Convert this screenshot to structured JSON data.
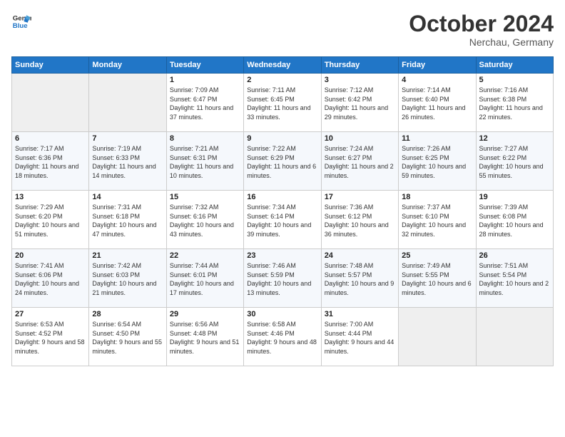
{
  "app": {
    "logo_line1": "General",
    "logo_line2": "Blue"
  },
  "header": {
    "month": "October 2024",
    "location": "Nerchau, Germany"
  },
  "weekdays": [
    "Sunday",
    "Monday",
    "Tuesday",
    "Wednesday",
    "Thursday",
    "Friday",
    "Saturday"
  ],
  "weeks": [
    [
      {
        "day": "",
        "empty": true
      },
      {
        "day": "",
        "empty": true
      },
      {
        "day": "1",
        "sunrise": "Sunrise: 7:09 AM",
        "sunset": "Sunset: 6:47 PM",
        "daylight": "Daylight: 11 hours and 37 minutes."
      },
      {
        "day": "2",
        "sunrise": "Sunrise: 7:11 AM",
        "sunset": "Sunset: 6:45 PM",
        "daylight": "Daylight: 11 hours and 33 minutes."
      },
      {
        "day": "3",
        "sunrise": "Sunrise: 7:12 AM",
        "sunset": "Sunset: 6:42 PM",
        "daylight": "Daylight: 11 hours and 29 minutes."
      },
      {
        "day": "4",
        "sunrise": "Sunrise: 7:14 AM",
        "sunset": "Sunset: 6:40 PM",
        "daylight": "Daylight: 11 hours and 26 minutes."
      },
      {
        "day": "5",
        "sunrise": "Sunrise: 7:16 AM",
        "sunset": "Sunset: 6:38 PM",
        "daylight": "Daylight: 11 hours and 22 minutes."
      }
    ],
    [
      {
        "day": "6",
        "sunrise": "Sunrise: 7:17 AM",
        "sunset": "Sunset: 6:36 PM",
        "daylight": "Daylight: 11 hours and 18 minutes."
      },
      {
        "day": "7",
        "sunrise": "Sunrise: 7:19 AM",
        "sunset": "Sunset: 6:33 PM",
        "daylight": "Daylight: 11 hours and 14 minutes."
      },
      {
        "day": "8",
        "sunrise": "Sunrise: 7:21 AM",
        "sunset": "Sunset: 6:31 PM",
        "daylight": "Daylight: 11 hours and 10 minutes."
      },
      {
        "day": "9",
        "sunrise": "Sunrise: 7:22 AM",
        "sunset": "Sunset: 6:29 PM",
        "daylight": "Daylight: 11 hours and 6 minutes."
      },
      {
        "day": "10",
        "sunrise": "Sunrise: 7:24 AM",
        "sunset": "Sunset: 6:27 PM",
        "daylight": "Daylight: 11 hours and 2 minutes."
      },
      {
        "day": "11",
        "sunrise": "Sunrise: 7:26 AM",
        "sunset": "Sunset: 6:25 PM",
        "daylight": "Daylight: 10 hours and 59 minutes."
      },
      {
        "day": "12",
        "sunrise": "Sunrise: 7:27 AM",
        "sunset": "Sunset: 6:22 PM",
        "daylight": "Daylight: 10 hours and 55 minutes."
      }
    ],
    [
      {
        "day": "13",
        "sunrise": "Sunrise: 7:29 AM",
        "sunset": "Sunset: 6:20 PM",
        "daylight": "Daylight: 10 hours and 51 minutes."
      },
      {
        "day": "14",
        "sunrise": "Sunrise: 7:31 AM",
        "sunset": "Sunset: 6:18 PM",
        "daylight": "Daylight: 10 hours and 47 minutes."
      },
      {
        "day": "15",
        "sunrise": "Sunrise: 7:32 AM",
        "sunset": "Sunset: 6:16 PM",
        "daylight": "Daylight: 10 hours and 43 minutes."
      },
      {
        "day": "16",
        "sunrise": "Sunrise: 7:34 AM",
        "sunset": "Sunset: 6:14 PM",
        "daylight": "Daylight: 10 hours and 39 minutes."
      },
      {
        "day": "17",
        "sunrise": "Sunrise: 7:36 AM",
        "sunset": "Sunset: 6:12 PM",
        "daylight": "Daylight: 10 hours and 36 minutes."
      },
      {
        "day": "18",
        "sunrise": "Sunrise: 7:37 AM",
        "sunset": "Sunset: 6:10 PM",
        "daylight": "Daylight: 10 hours and 32 minutes."
      },
      {
        "day": "19",
        "sunrise": "Sunrise: 7:39 AM",
        "sunset": "Sunset: 6:08 PM",
        "daylight": "Daylight: 10 hours and 28 minutes."
      }
    ],
    [
      {
        "day": "20",
        "sunrise": "Sunrise: 7:41 AM",
        "sunset": "Sunset: 6:06 PM",
        "daylight": "Daylight: 10 hours and 24 minutes."
      },
      {
        "day": "21",
        "sunrise": "Sunrise: 7:42 AM",
        "sunset": "Sunset: 6:03 PM",
        "daylight": "Daylight: 10 hours and 21 minutes."
      },
      {
        "day": "22",
        "sunrise": "Sunrise: 7:44 AM",
        "sunset": "Sunset: 6:01 PM",
        "daylight": "Daylight: 10 hours and 17 minutes."
      },
      {
        "day": "23",
        "sunrise": "Sunrise: 7:46 AM",
        "sunset": "Sunset: 5:59 PM",
        "daylight": "Daylight: 10 hours and 13 minutes."
      },
      {
        "day": "24",
        "sunrise": "Sunrise: 7:48 AM",
        "sunset": "Sunset: 5:57 PM",
        "daylight": "Daylight: 10 hours and 9 minutes."
      },
      {
        "day": "25",
        "sunrise": "Sunrise: 7:49 AM",
        "sunset": "Sunset: 5:55 PM",
        "daylight": "Daylight: 10 hours and 6 minutes."
      },
      {
        "day": "26",
        "sunrise": "Sunrise: 7:51 AM",
        "sunset": "Sunset: 5:54 PM",
        "daylight": "Daylight: 10 hours and 2 minutes."
      }
    ],
    [
      {
        "day": "27",
        "sunrise": "Sunrise: 6:53 AM",
        "sunset": "Sunset: 4:52 PM",
        "daylight": "Daylight: 9 hours and 58 minutes."
      },
      {
        "day": "28",
        "sunrise": "Sunrise: 6:54 AM",
        "sunset": "Sunset: 4:50 PM",
        "daylight": "Daylight: 9 hours and 55 minutes."
      },
      {
        "day": "29",
        "sunrise": "Sunrise: 6:56 AM",
        "sunset": "Sunset: 4:48 PM",
        "daylight": "Daylight: 9 hours and 51 minutes."
      },
      {
        "day": "30",
        "sunrise": "Sunrise: 6:58 AM",
        "sunset": "Sunset: 4:46 PM",
        "daylight": "Daylight: 9 hours and 48 minutes."
      },
      {
        "day": "31",
        "sunrise": "Sunrise: 7:00 AM",
        "sunset": "Sunset: 4:44 PM",
        "daylight": "Daylight: 9 hours and 44 minutes."
      },
      {
        "day": "",
        "empty": true
      },
      {
        "day": "",
        "empty": true
      }
    ]
  ]
}
